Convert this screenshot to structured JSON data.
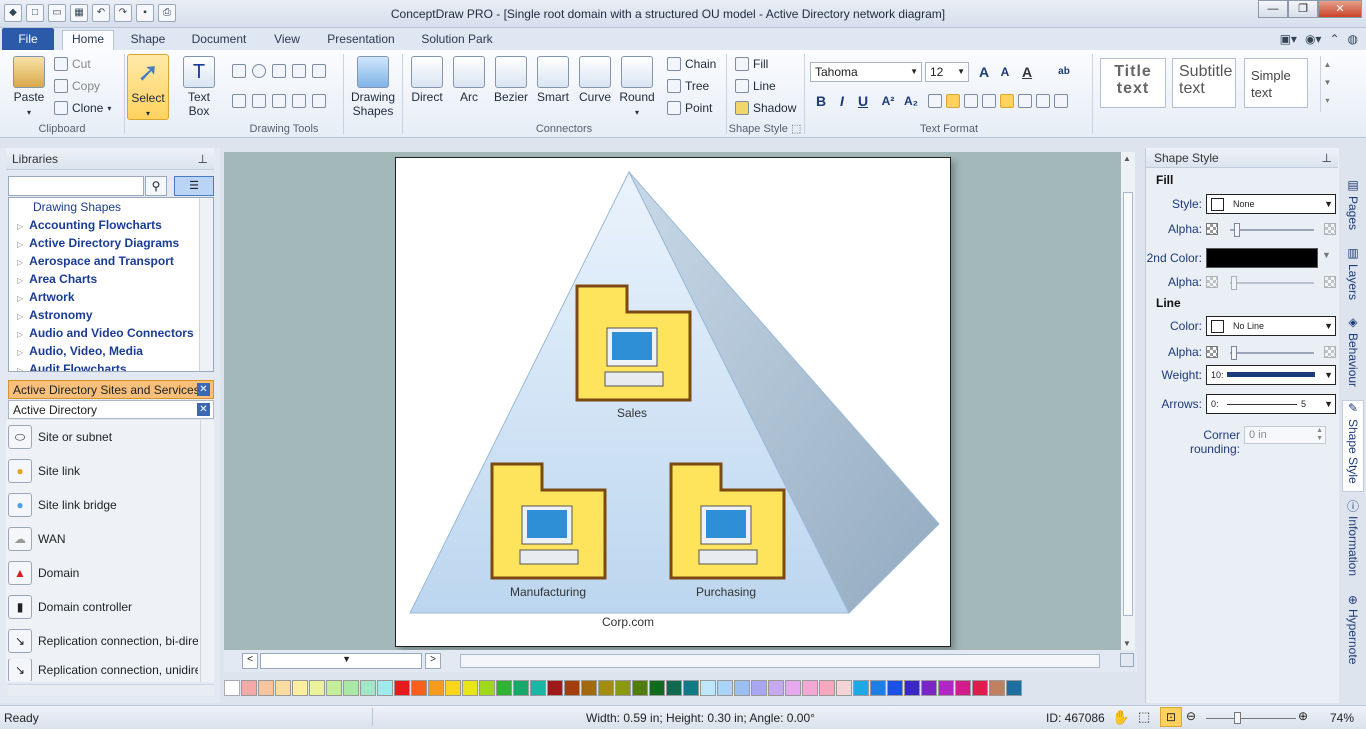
{
  "window": {
    "title": "ConceptDraw PRO - [Single root domain with a structured OU model - Active Directory network diagram]"
  },
  "menu": {
    "tabs": [
      "File",
      "Home",
      "Shape",
      "Document",
      "View",
      "Presentation",
      "Solution Park"
    ]
  },
  "ribbon": {
    "clipboard": {
      "paste": "Paste",
      "cut": "Cut",
      "copy": "Copy",
      "clone": "Clone",
      "group": "Clipboard"
    },
    "drawing_tools": {
      "select": "Select",
      "text_box": "Text Box",
      "group": "Drawing Tools"
    },
    "drawing_shapes": {
      "label": "Drawing Shapes"
    },
    "connectors": {
      "items": [
        "Direct",
        "Arc",
        "Bezier",
        "Smart",
        "Curve",
        "Round"
      ],
      "chain": "Chain",
      "tree": "Tree",
      "point": "Point",
      "group": "Connectors"
    },
    "shape_style": {
      "fill": "Fill",
      "line": "Line",
      "shadow": "Shadow",
      "group": "Shape Style"
    },
    "text_format": {
      "font": "Tahoma",
      "size": "12",
      "group": "Text Format"
    },
    "styles": {
      "title": "Title text",
      "subtitle": "Subtitle text",
      "simple": "Simple text"
    }
  },
  "libraries": {
    "header": "Libraries",
    "items": [
      "Drawing Shapes",
      "Accounting Flowcharts",
      "Active Directory Diagrams",
      "Aerospace and Transport",
      "Area Charts",
      "Artwork",
      "Astronomy",
      "Audio and Video Connectors",
      "Audio, Video, Media",
      "Audit Flowcharts"
    ],
    "open": [
      "Active Directory Sites and Services",
      "Active Directory"
    ],
    "shapes": [
      "Site or subnet",
      "Site link",
      "Site link bridge",
      "WAN",
      "Domain",
      "Domain controller",
      "Replication connection, bi-directional",
      "Replication connection, unidirectional"
    ]
  },
  "diagram": {
    "ous": [
      "Sales",
      "Manufacturing",
      "Purchasing"
    ],
    "domain": "Corp.com"
  },
  "shape_style_panel": {
    "header": "Shape Style",
    "fill": "Fill",
    "style_label": "Style:",
    "style_value": "None",
    "alpha_label": "Alpha:",
    "second_color_label": "2nd Color:",
    "line": "Line",
    "color_label": "Color:",
    "color_value": "No Line",
    "weight_label": "Weight:",
    "weight_value": "10:",
    "arrows_label": "Arrows:",
    "arrows_from": "0:",
    "arrows_to": "5",
    "corner_label": "Corner rounding:",
    "corner_value": "0 in"
  },
  "side_tabs": [
    "Pages",
    "Layers",
    "Behaviour",
    "Shape Style",
    "Information",
    "Hypernote"
  ],
  "status": {
    "ready": "Ready",
    "dims": "Width: 0.59 in;  Height: 0.30 in;  Angle: 0.00°",
    "id": "ID: 467086",
    "zoom": "74%"
  },
  "colors": {
    "palette": [
      "#f5a8a8",
      "#f7c4a0",
      "#f9dca2",
      "#fbee9e",
      "#eaf29a",
      "#c6ee9a",
      "#a8e8a4",
      "#a2e8c8",
      "#9eeaec",
      "#e61b1b",
      "#f7611b",
      "#f99b1c",
      "#fdd51b",
      "#e8e618",
      "#9fd81d",
      "#2fb335",
      "#1aa86a",
      "#1bb5a6",
      "#a01919",
      "#a33e0f",
      "#a3690f",
      "#a38e0f",
      "#8a9a0e",
      "#4f7d0e",
      "#0f6b1e",
      "#0f6a4e",
      "#0f7b82",
      "#bfe6f8",
      "#a8d5f6",
      "#9cbff2",
      "#a7a8ef",
      "#c5a8ee",
      "#e6a8ee",
      "#f2a8d4",
      "#f5a8be",
      "#f2d4d4",
      "#1ca7e6",
      "#1c7ee6",
      "#1c50e6",
      "#3b26c6",
      "#7a26c6",
      "#b126c6",
      "#d21c8c",
      "#e01c4d",
      "#c08060",
      "#1e6fa0"
    ]
  }
}
